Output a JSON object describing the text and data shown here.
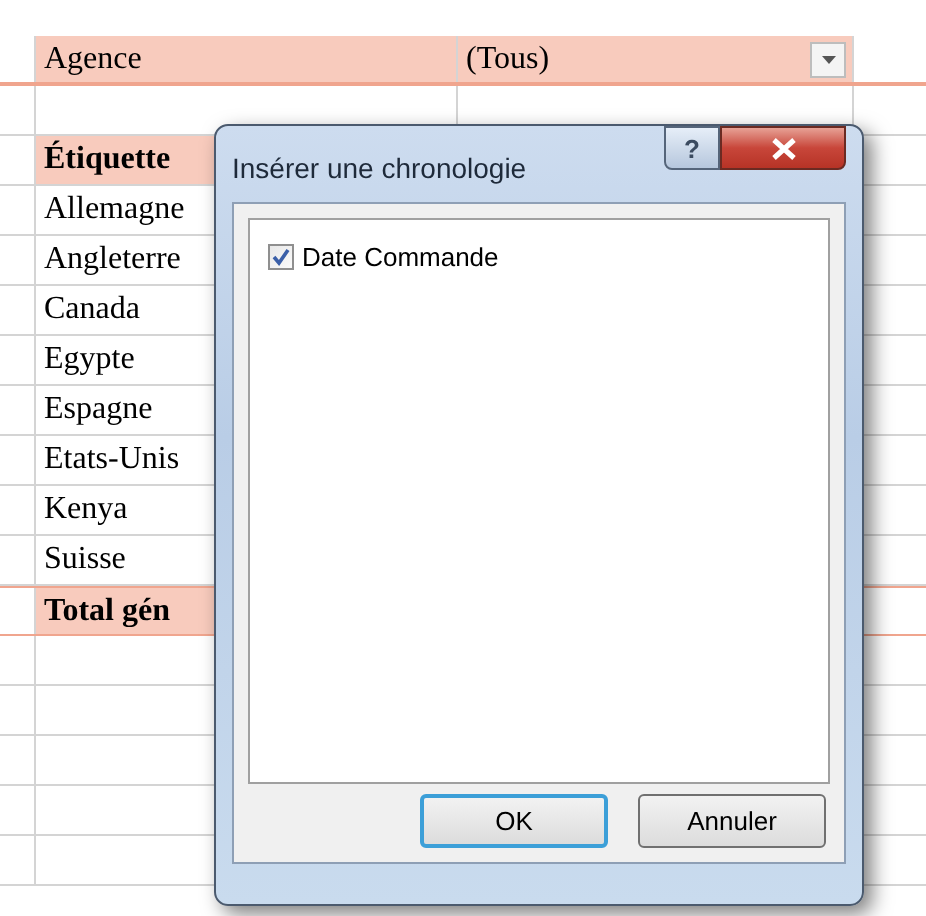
{
  "sheet": {
    "filter": {
      "label": "Agence",
      "value": "(Tous)"
    },
    "rows": [
      {
        "kind": "header",
        "label": "Étiquette"
      },
      {
        "kind": "item",
        "label": "Allemagne"
      },
      {
        "kind": "item",
        "label": "Angleterre"
      },
      {
        "kind": "item",
        "label": "Canada"
      },
      {
        "kind": "item",
        "label": "Egypte"
      },
      {
        "kind": "item",
        "label": "Espagne"
      },
      {
        "kind": "item",
        "label": "Etats-Unis"
      },
      {
        "kind": "item",
        "label": "Kenya"
      },
      {
        "kind": "item",
        "label": "Suisse"
      },
      {
        "kind": "total",
        "label": "Total gén"
      }
    ]
  },
  "dialog": {
    "title": "Insérer une chronologie",
    "help": "?",
    "fields": [
      {
        "label": "Date Commande",
        "checked": true
      }
    ],
    "buttons": [
      {
        "label": "OK",
        "default": true
      },
      {
        "label": "Annuler",
        "default": false
      }
    ]
  }
}
